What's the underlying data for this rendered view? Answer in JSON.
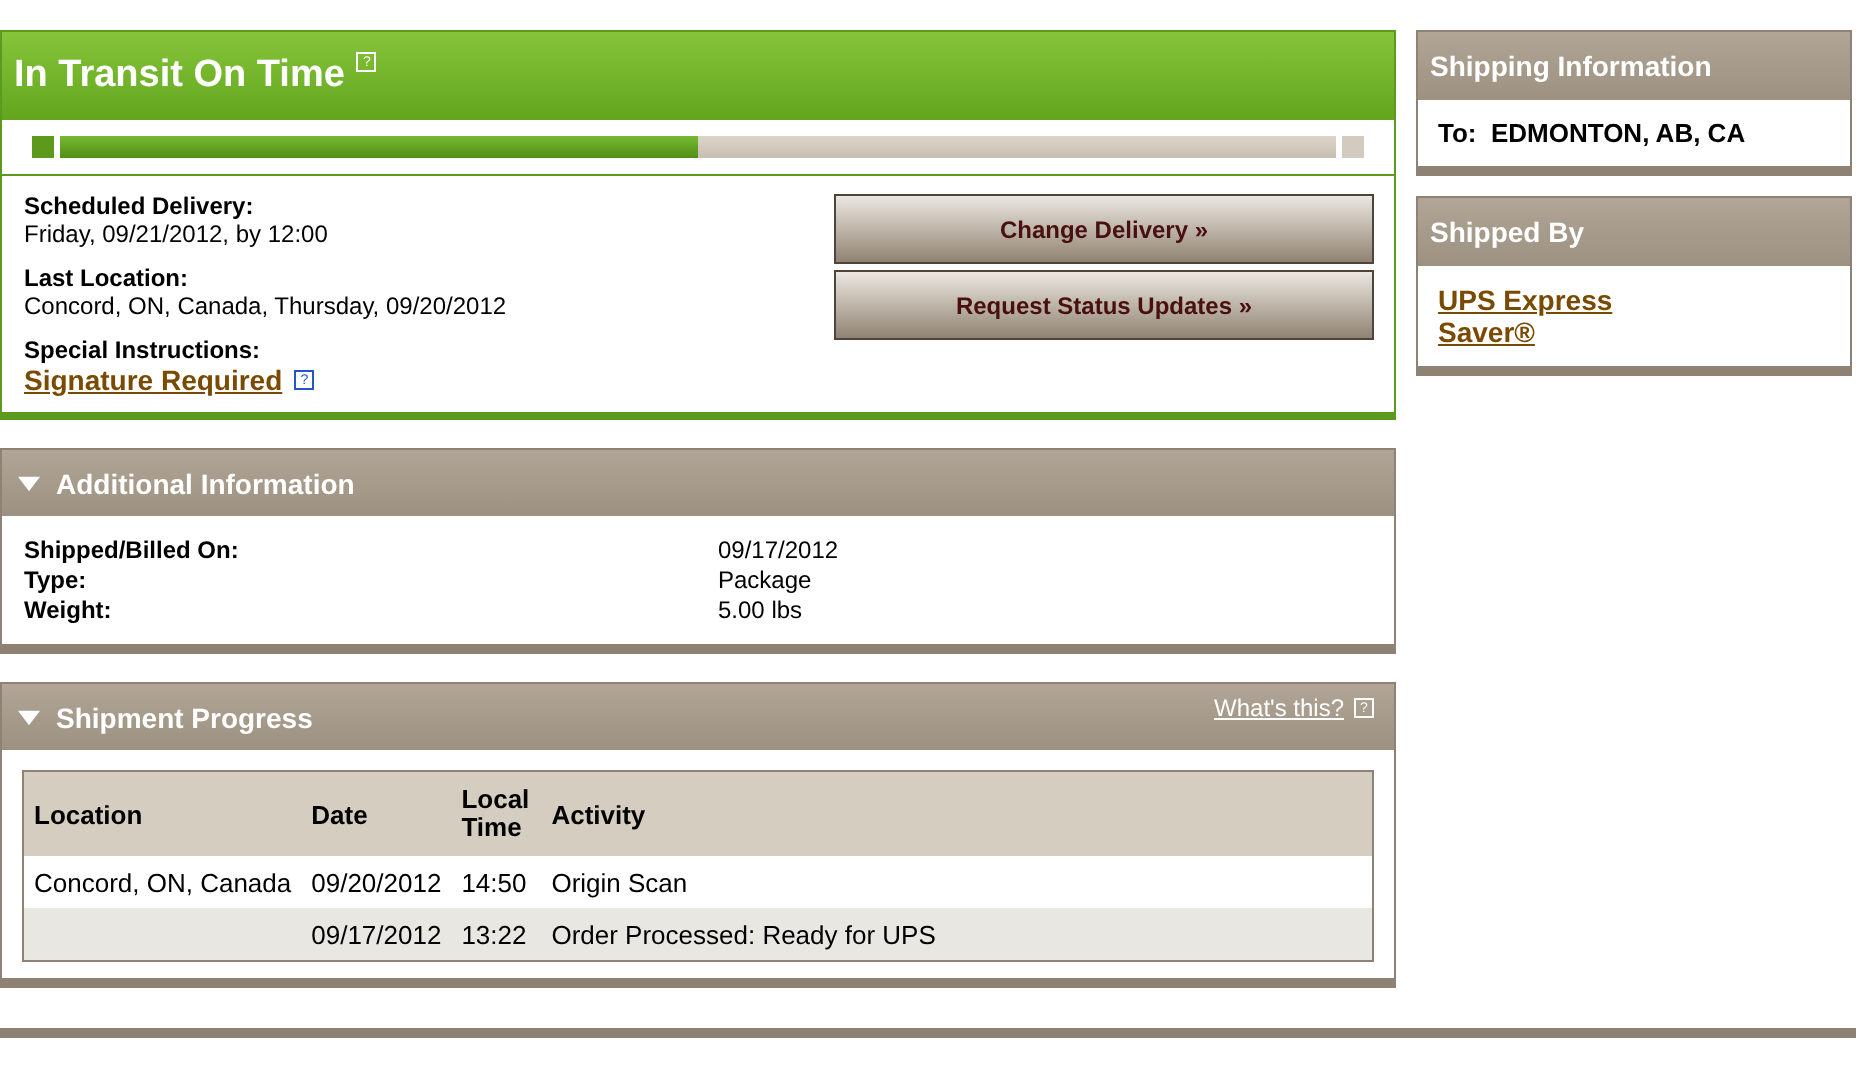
{
  "status": {
    "title": "In Transit On Time",
    "help": "?",
    "progress": {
      "level": 0.5
    },
    "details": [
      {
        "label": "Scheduled Delivery:",
        "value": "Friday, 09/21/2012, by 12:00",
        "kind": "text"
      },
      {
        "label": "Last Location:",
        "value": "Concord, ON, Canada, Thursday, 09/20/2012",
        "kind": "text"
      },
      {
        "label": "Special Instructions:",
        "value": "Signature Required",
        "kind": "link"
      }
    ],
    "buttons": [
      "Change Delivery »",
      "Request Status Updates »"
    ]
  },
  "additional_information": {
    "title": "Additional Information",
    "expanded": true,
    "rows": [
      {
        "label": "Shipped/Billed On:",
        "value": "09/17/2012"
      },
      {
        "label": "Type:",
        "value": "Package"
      },
      {
        "label": "Weight:",
        "value": "5.00 lbs"
      }
    ]
  },
  "shipment_progress": {
    "title": "Shipment Progress",
    "expanded": true,
    "help_link": "What's this?",
    "columns": [
      "Location",
      "Date",
      "Local Time",
      "Activity"
    ],
    "rows": [
      [
        "Concord, ON, Canada",
        "09/20/2012",
        "14:50",
        "Origin Scan"
      ],
      [
        "",
        "09/17/2012",
        "13:22",
        "Order Processed: Ready for UPS"
      ]
    ]
  },
  "shipping_information": {
    "title": "Shipping Information",
    "label": "To:",
    "value": "EDMONTON, AB, CA"
  },
  "shipped_by": {
    "title": "Shipped By",
    "service": "UPS Express Saver®"
  }
}
